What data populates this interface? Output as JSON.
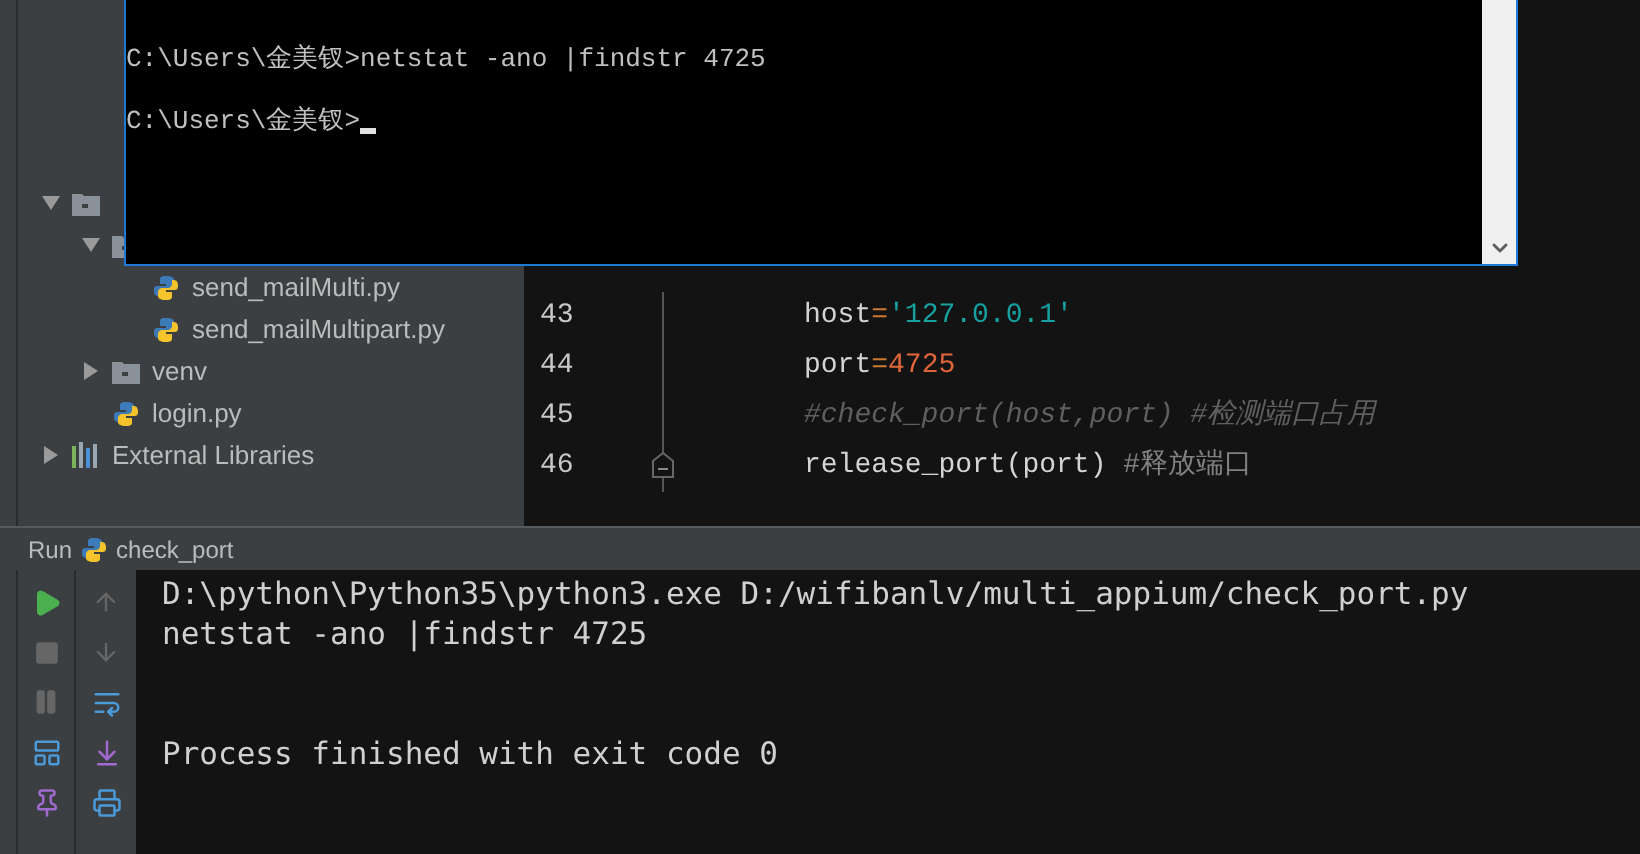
{
  "project_tree": [
    {
      "kind": "folder",
      "expanded": true,
      "children": [
        {
          "kind": "folder",
          "expanded": true,
          "children": [
            {
              "kind": "file",
              "label": "send_mailMulti.py"
            },
            {
              "kind": "file",
              "label": "send_mailMultipart.py"
            }
          ]
        },
        {
          "kind": "folder",
          "label": "venv",
          "expanded": false
        },
        {
          "kind": "file",
          "label": "login.py"
        }
      ]
    },
    {
      "kind": "library",
      "label": "External Libraries",
      "expanded": false
    }
  ],
  "editor": {
    "lines": [
      {
        "number": "43",
        "fold_end": false,
        "tokens": [
          {
            "kind": "plain",
            "text": "host"
          },
          {
            "kind": "op",
            "text": "="
          },
          {
            "kind": "string",
            "text": "'127.0.0.1'"
          }
        ]
      },
      {
        "number": "44",
        "fold_end": false,
        "tokens": [
          {
            "kind": "plain",
            "text": "port"
          },
          {
            "kind": "op",
            "text": "="
          },
          {
            "kind": "number",
            "text": "4725"
          }
        ]
      },
      {
        "number": "45",
        "fold_end": false,
        "tokens": [
          {
            "kind": "comment",
            "text": "#check_port(host,port) #检测端口占用"
          }
        ]
      },
      {
        "number": "46",
        "fold_end": true,
        "tokens": [
          {
            "kind": "plain",
            "text": "release_port(port) "
          },
          {
            "kind": "note",
            "text": "#释放端口"
          }
        ]
      }
    ]
  },
  "run_panel": {
    "label": "Run",
    "config": "check_port",
    "console": [
      {
        "kind": "output",
        "text": "D:\\python\\Python35\\python3.exe D:/wifibanlv/multi_appium/check_port.py"
      },
      {
        "kind": "output",
        "text": "netstat -ano |findstr 4725"
      },
      {
        "kind": "status",
        "text": "Process finished with exit code 0"
      }
    ]
  },
  "cmd_window": {
    "lines": [
      {
        "kind": "command",
        "text": "C:\\Users\\金美钗>netstat -ano |findstr 4725"
      },
      {
        "kind": "prompt",
        "text": "C:\\Users\\金美钗>"
      }
    ]
  }
}
